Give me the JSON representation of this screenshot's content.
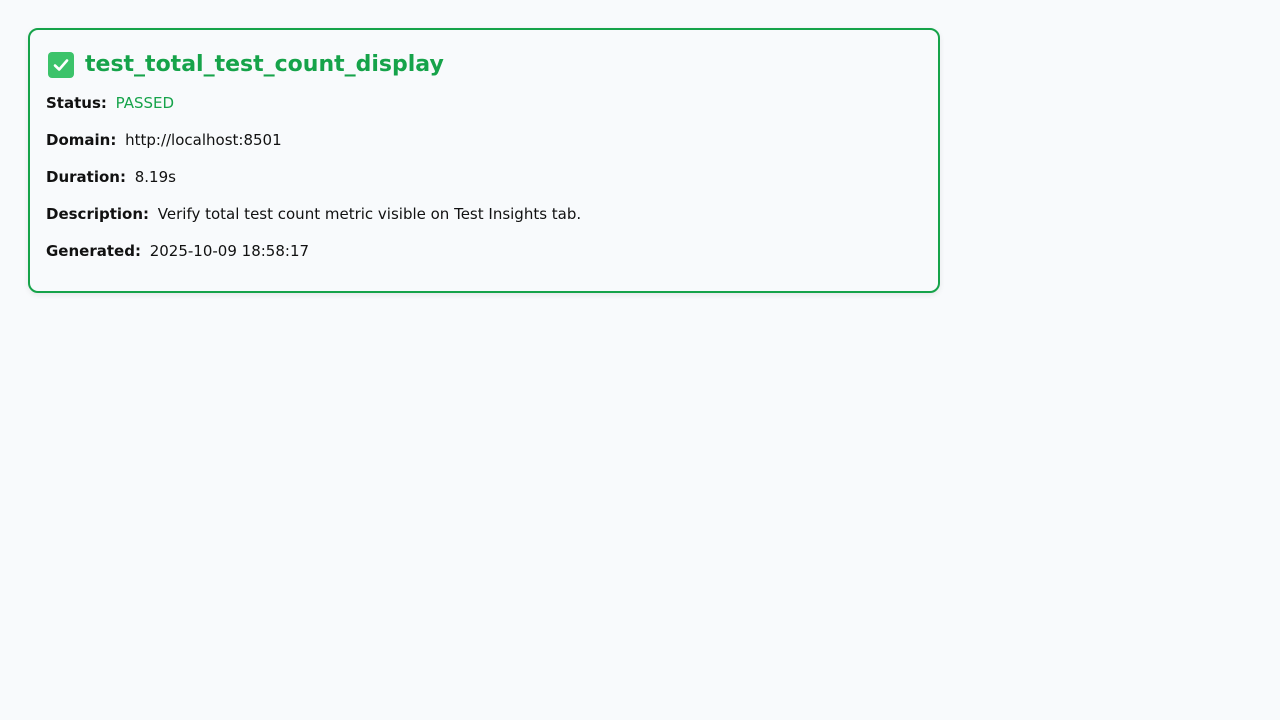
{
  "report": {
    "icon": "check-box-icon",
    "title": "test_total_test_count_display",
    "status_label": "Status:",
    "status_value": "PASSED",
    "domain_label": "Domain:",
    "domain_value": "http://localhost:8501",
    "duration_label": "Duration:",
    "duration_value": "8.19s",
    "description_label": "Description:",
    "description_value": "Verify total test count metric visible on Test Insights tab.",
    "generated_label": "Generated:",
    "generated_value": "2025-10-09 18:58:17"
  },
  "colors": {
    "accent": "#16a34a",
    "background": "#f8fafc",
    "icon_bg": "#3cc36a"
  }
}
